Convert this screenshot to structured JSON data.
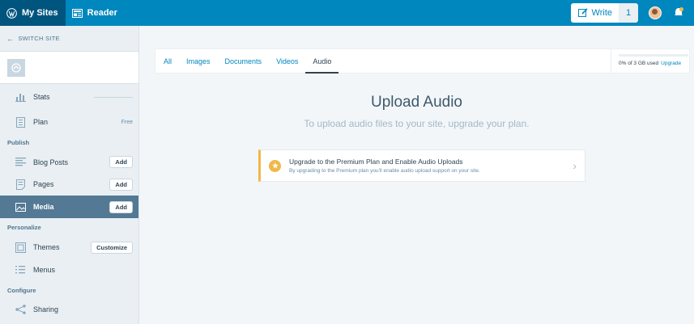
{
  "masterbar": {
    "my_sites": "My Sites",
    "reader": "Reader",
    "write": "Write",
    "write_count": "1"
  },
  "sidebar": {
    "switch_site": "SWITCH SITE",
    "stats": "Stats",
    "plan": "Plan",
    "plan_badge": "Free",
    "section_publish": "Publish",
    "blog_posts": "Blog Posts",
    "pages": "Pages",
    "media": "Media",
    "add": "Add",
    "section_personalize": "Personalize",
    "themes": "Themes",
    "customize": "Customize",
    "menus": "Menus",
    "section_configure": "Configure",
    "sharing": "Sharing"
  },
  "tabs": [
    "All",
    "Images",
    "Documents",
    "Videos",
    "Audio"
  ],
  "active_tab": "Audio",
  "storage": {
    "used_text": "0% of 3 GB used",
    "upgrade": "Upgrade",
    "percent": 0
  },
  "main": {
    "title": "Upload Audio",
    "subtitle": "To upload audio files to your site, upgrade your plan."
  },
  "nudge": {
    "title": "Upgrade to the Premium Plan and Enable Audio Uploads",
    "description": "By upgrading to the Premium plan you'll enable audio upload support on your site."
  },
  "colors": {
    "masterbar": "#0087be",
    "sidebar_active": "#537994",
    "nudge_accent": "#f0b849"
  }
}
